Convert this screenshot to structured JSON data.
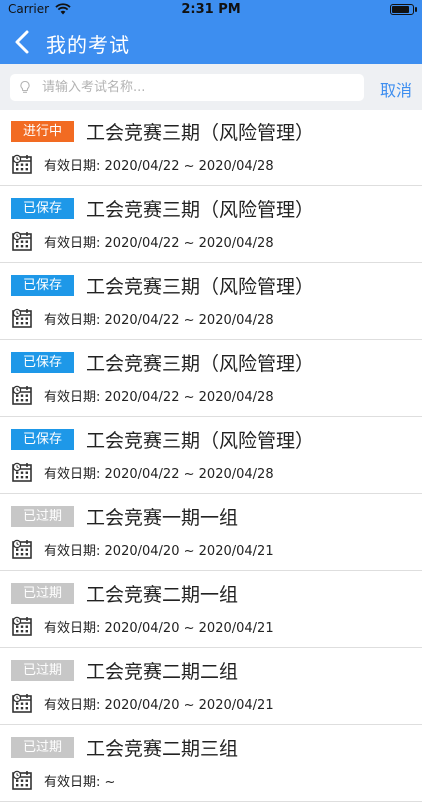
{
  "status_bar": {
    "carrier": "Carrier",
    "time": "2:31 PM",
    "battery_level": 0.9
  },
  "nav": {
    "title": "我的考试"
  },
  "search": {
    "placeholder": "请输入考试名称...",
    "value": "",
    "cancel_label": "取消"
  },
  "date_label": "有效日期:",
  "date_separator": "~",
  "status_colors": {
    "进行中": "#f26b22",
    "已保存": "#1e98e8",
    "已过期": "#c7c7c7"
  },
  "exams": [
    {
      "status": "进行中",
      "title": "工会竞赛三期（风险管理）",
      "start": "2020/04/22",
      "end": "2020/04/28"
    },
    {
      "status": "已保存",
      "title": "工会竞赛三期（风险管理）",
      "start": "2020/04/22",
      "end": "2020/04/28"
    },
    {
      "status": "已保存",
      "title": "工会竞赛三期（风险管理）",
      "start": "2020/04/22",
      "end": "2020/04/28"
    },
    {
      "status": "已保存",
      "title": "工会竞赛三期（风险管理）",
      "start": "2020/04/22",
      "end": "2020/04/28"
    },
    {
      "status": "已保存",
      "title": "工会竞赛三期（风险管理）",
      "start": "2020/04/22",
      "end": "2020/04/28"
    },
    {
      "status": "已过期",
      "title": "工会竞赛一期一组",
      "start": "2020/04/20",
      "end": "2020/04/21"
    },
    {
      "status": "已过期",
      "title": "工会竞赛二期一组",
      "start": "2020/04/20",
      "end": "2020/04/21"
    },
    {
      "status": "已过期",
      "title": "工会竞赛二期二组",
      "start": "2020/04/20",
      "end": "2020/04/21"
    },
    {
      "status": "已过期",
      "title": "工会竞赛二期三组",
      "start": "",
      "end": ""
    }
  ]
}
